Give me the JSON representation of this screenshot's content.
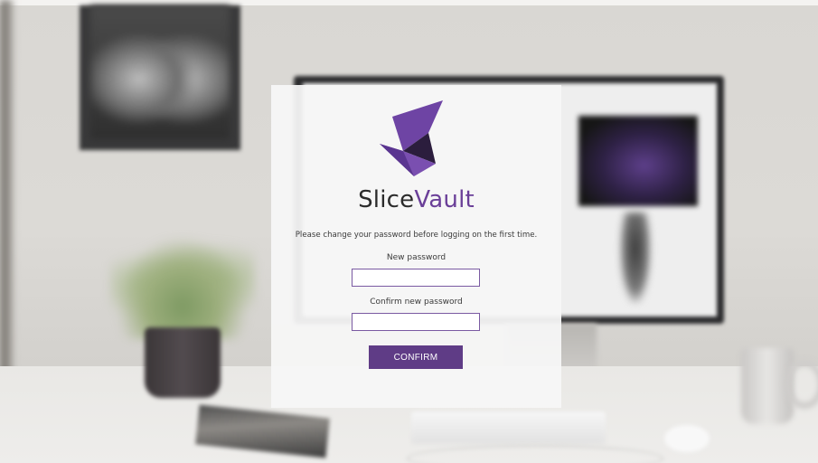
{
  "brand": {
    "name_part1": "Slice",
    "name_part2": "Vault",
    "logo_icon": "slicevault-logo-icon",
    "colors": {
      "accent": "#5f3c86",
      "logo_light": "#6e44a4",
      "logo_dark": "#2b1d3d",
      "text": "#2b2b2b"
    }
  },
  "form": {
    "message": "Please change your password before logging on the first time.",
    "new_password_label": "New password",
    "new_password_value": "",
    "confirm_password_label": "Confirm new password",
    "confirm_password_value": "",
    "confirm_button_label": "CONFIRM"
  }
}
